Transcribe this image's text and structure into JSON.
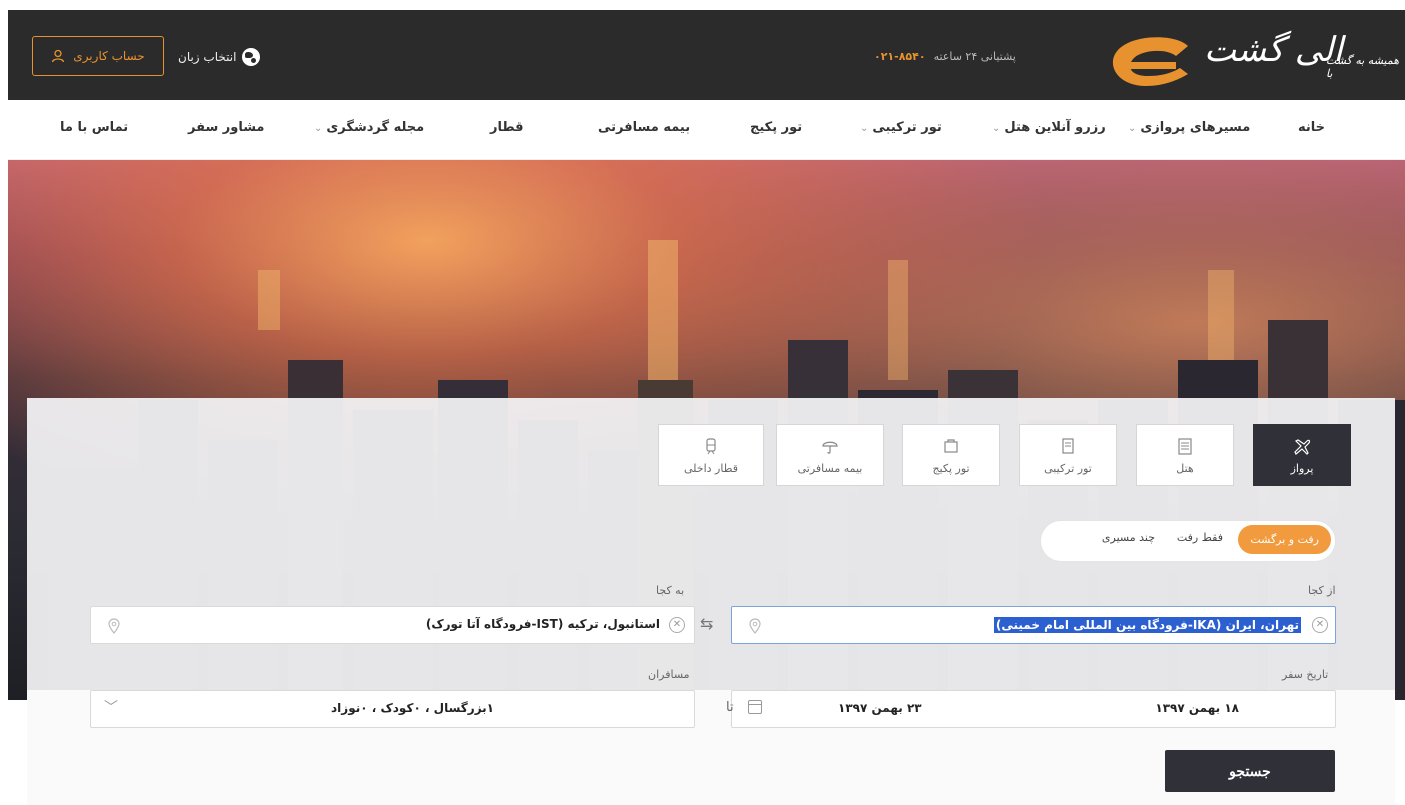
{
  "topbar": {
    "account_label": "حساب کاربری",
    "language_label": "انتخاب زبان",
    "support_text": "پشتیانی ۲۴ ساعته",
    "support_phone": "۰۲۱-۸۵۴۰",
    "logo_text": "الی گشت",
    "logo_tagline": "همیشه به گشت با",
    "brand_color": "#e8922f"
  },
  "nav": {
    "items": [
      {
        "label": "خانه"
      },
      {
        "label": "مسیرهای پروازی"
      },
      {
        "label": "رزرو آنلاین هتل"
      },
      {
        "label": "تور ترکیبی"
      },
      {
        "label": "تور پکیج"
      },
      {
        "label": "بیمه مسافرتی"
      },
      {
        "label": "قطار"
      },
      {
        "label": "مجله گردشگری"
      },
      {
        "label": "مشاور سفر"
      },
      {
        "label": "تماس با ما"
      }
    ]
  },
  "tabs": [
    {
      "label": "پرواز",
      "icon": "plane-icon",
      "active": true
    },
    {
      "label": "هتل",
      "icon": "hotel-icon"
    },
    {
      "label": "تور ترکیبی",
      "icon": "combo-tour-icon"
    },
    {
      "label": "تور پکیج",
      "icon": "package-tour-icon"
    },
    {
      "label": "بیمه مسافرتی",
      "icon": "umbrella-icon"
    },
    {
      "label": "قطار داخلی",
      "icon": "train-icon"
    }
  ],
  "trip_type": {
    "options": [
      "رفت و برگشت",
      "فقط رفت",
      "چند مسیری"
    ],
    "selected": "رفت و برگشت"
  },
  "search": {
    "from_label": "از کجا",
    "from_value": "تهران، ایران (IKA-فرودگاه بین المللی امام خمینی)",
    "to_label": "به کجا",
    "to_value": "استانبول، ترکیه (IST-فرودگاه آتا تورک)",
    "date_label": "تاریخ سفر",
    "depart_date": "۱۸ بهمن ۱۳۹۷",
    "return_date": "۲۳ بهمن ۱۳۹۷",
    "to_separator": "تا",
    "passengers_label": "مسافران",
    "passengers_value": "۱بزرگسال ، ۰کودک ، ۰نوزاد",
    "search_button": "جستجو"
  }
}
